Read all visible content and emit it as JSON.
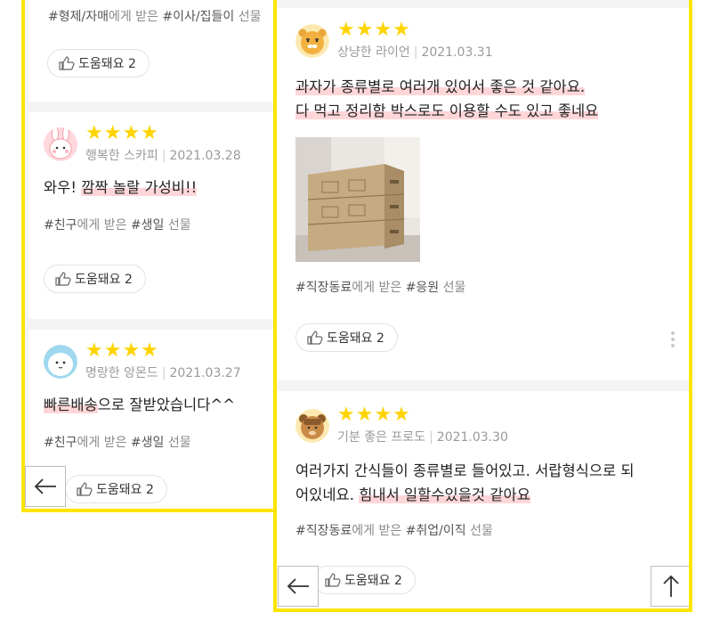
{
  "left_panel": {
    "top_card": {
      "tags": {
        "t1": "#형제/자매",
        "t2": "에게 받은 ",
        "t3": "#이사/집들이",
        "t4": " 선물"
      },
      "helpful_label": "도움돼요 2"
    },
    "card2": {
      "stars": "★★★★",
      "nickname": "행복한 스카피",
      "date": "2021.03.28",
      "review_plain": "와우! ",
      "review_highlight": "깜짝 놀랄 가성비!!",
      "tags": {
        "t1": "#친구",
        "t2": "에게 받은 ",
        "t3": "#생일",
        "t4": " 선물"
      },
      "helpful_label": "도움돼요 2"
    },
    "card3": {
      "stars": "★★★★",
      "nickname": "명랑한 앙몬드",
      "date": "2021.03.27",
      "review_highlight": "빠른배송",
      "review_plain": "으로 잘받았습니다^^",
      "tags": {
        "t1": "#친구",
        "t2": "에게 받은 ",
        "t3": "#생일",
        "t4": " 선물"
      },
      "helpful_label": "도움돼요 2"
    }
  },
  "right_panel": {
    "card1": {
      "stars": "★★★★",
      "nickname": "상냥한 라이언",
      "date": "2021.03.31",
      "review_line1": "과자가 종류별로 여러개 있어서 좋은 것 같아요.",
      "review_line2": "다 먹고 정리함 박스로도 이용할 수도 있고 좋네요",
      "tags": {
        "t1": "#직장동료",
        "t2": "에게 받은 ",
        "t3": "#응원",
        "t4": " 선물"
      },
      "helpful_label": "도움돼요 2"
    },
    "card2": {
      "stars": "★★★★",
      "nickname": "기분 좋은 프로도",
      "date": "2021.03.30",
      "review_line1": "여러가지 간식들이 종류별로 들어있고. 서랍형식으로 되",
      "review_line2_plain": "어있네요. ",
      "review_line2_highlight": "힘내서 일할수있을것 같아요",
      "tags": {
        "t1": "#직장동료",
        "t2": "에게 받은 ",
        "t3": "#취업/이직",
        "t4": " 선물"
      },
      "helpful_label": "도움돼요 2"
    }
  },
  "icons": {
    "back": "arrow-left-icon",
    "top": "arrow-up-icon",
    "thumb": "thumbs-up-icon",
    "more": "more-vertical-icon"
  },
  "colors": {
    "frame": "#fde500",
    "star": "#ffd400",
    "highlight": "#ffb4b9"
  }
}
